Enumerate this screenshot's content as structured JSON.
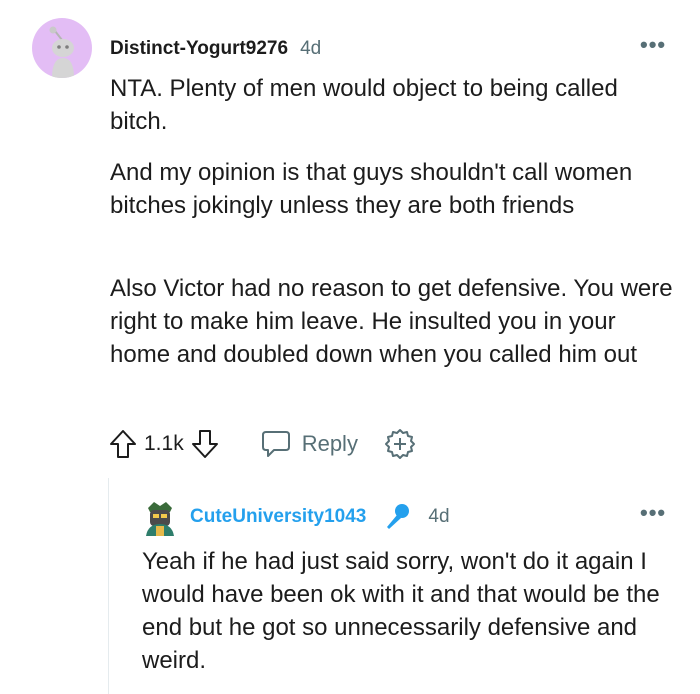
{
  "comment": {
    "username": "Distinct-Yogurt9276",
    "time": "4d",
    "paragraphs": [
      "NTA. Plenty of men would object to being called bitch.",
      "And my opinion is that guys shouldn't call women bitches jokingly unless they are both friends",
      "Also Victor had no reason to get defensive. You were right to make him leave. He insulted you in your home and doubled down when you called him out"
    ],
    "votes": "1.1k",
    "reply_label": "Reply",
    "more_label": "•••"
  },
  "reply": {
    "username": "CuteUniversity1043",
    "time": "4d",
    "text": "Yeah if he had just said sorry, won't do it again I would have been ok with it and that would be the end but he got so unnecessarily defensive and weird.",
    "more_label": "•••"
  },
  "colors": {
    "avatar_bg": "#e3bdf5",
    "reply_username": "#24a0ed",
    "meta_gray": "#576f76"
  },
  "icons": [
    "snoo-avatar-icon",
    "more-options-icon",
    "upvote-icon",
    "downvote-icon",
    "reply-icon",
    "award-icon",
    "microphone-icon",
    "user-avatar-icon"
  ]
}
